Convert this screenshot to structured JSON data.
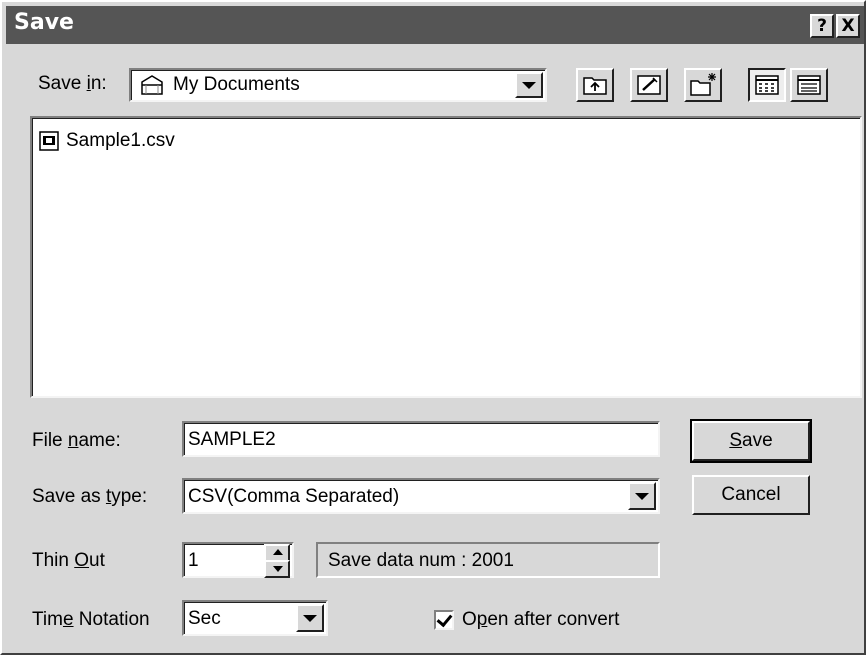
{
  "window": {
    "title": "Save",
    "help_label": "?",
    "close_label": "X"
  },
  "save_in": {
    "label_pre": "Save ",
    "label_key": "i",
    "label_post": "n:",
    "value": "My Documents"
  },
  "files": [
    {
      "name": "Sample1.csv"
    }
  ],
  "file_name": {
    "label_pre": "File ",
    "label_key": "n",
    "label_post": "ame:",
    "value": "SAMPLE2"
  },
  "save_as_type": {
    "label_pre": "Save as ",
    "label_key": "t",
    "label_post": "ype:",
    "value": "CSV(Comma Separated)"
  },
  "thin_out": {
    "label_pre": "Thin ",
    "label_key": "O",
    "label_post": "ut",
    "value": "1"
  },
  "save_data_num": "Save data num  : 2001",
  "time_notation": {
    "label_pre": "Tim",
    "label_key": "e",
    "label_post": " Notation",
    "value": "Sec"
  },
  "open_after_convert": {
    "label_pre": "O",
    "label_key": "p",
    "label_post": "en after convert",
    "checked": true
  },
  "buttons": {
    "save_key": "S",
    "save_rest": "ave",
    "cancel": "Cancel"
  },
  "colors": {
    "titlebar": "#555555",
    "face": "#d8d8d8",
    "window": "#ffffff"
  }
}
